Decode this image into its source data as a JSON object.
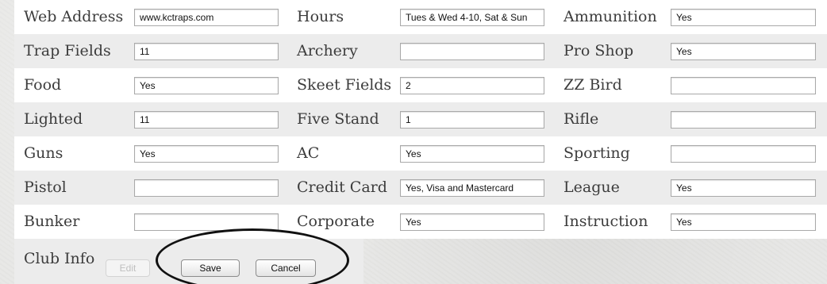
{
  "rows": [
    {
      "c1": {
        "label": "Web Address",
        "value": "www.kctraps.com"
      },
      "c2": {
        "label": "Hours",
        "value": "Tues & Wed 4-10, Sat & Sun"
      },
      "c3": {
        "label": "Ammunition",
        "value": "Yes"
      }
    },
    {
      "c1": {
        "label": "Trap Fields",
        "value": "11"
      },
      "c2": {
        "label": "Archery",
        "value": ""
      },
      "c3": {
        "label": "Pro Shop",
        "value": "Yes"
      }
    },
    {
      "c1": {
        "label": "Food",
        "value": "Yes"
      },
      "c2": {
        "label": "Skeet Fields",
        "value": "2"
      },
      "c3": {
        "label": "ZZ Bird",
        "value": ""
      }
    },
    {
      "c1": {
        "label": "Lighted",
        "value": "11"
      },
      "c2": {
        "label": "Five Stand",
        "value": "1"
      },
      "c3": {
        "label": "Rifle",
        "value": ""
      }
    },
    {
      "c1": {
        "label": "Guns",
        "value": "Yes"
      },
      "c2": {
        "label": "AC",
        "value": "Yes"
      },
      "c3": {
        "label": "Sporting",
        "value": ""
      }
    },
    {
      "c1": {
        "label": "Pistol",
        "value": ""
      },
      "c2": {
        "label": "Credit Card",
        "value": "Yes, Visa and Mastercard"
      },
      "c3": {
        "label": "League",
        "value": "Yes"
      }
    },
    {
      "c1": {
        "label": "Bunker",
        "value": ""
      },
      "c2": {
        "label": "Corporate",
        "value": "Yes"
      },
      "c3": {
        "label": "Instruction",
        "value": "Yes"
      }
    }
  ],
  "footer": {
    "label": "Club Info",
    "edit_label": "Edit",
    "save_label": "Save",
    "cancel_label": "Cancel"
  }
}
